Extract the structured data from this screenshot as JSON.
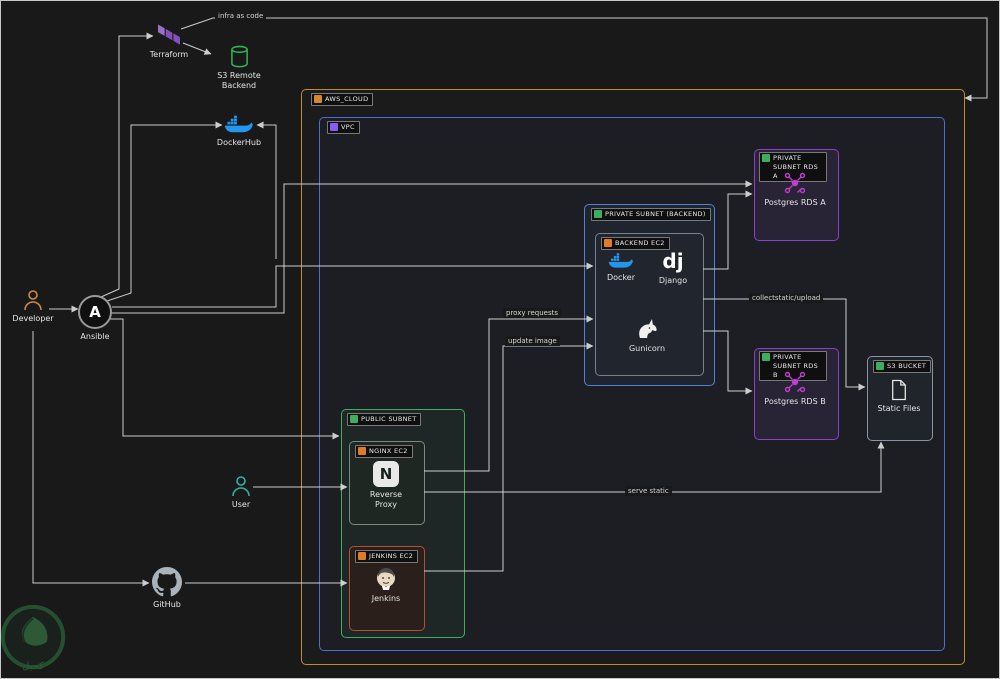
{
  "diagram": {
    "external": {
      "terraform": {
        "label": "Terraform"
      },
      "s3_remote_backend": {
        "label": "S3 Remote Backend"
      },
      "dockerhub": {
        "label": "DockerHub"
      },
      "developer": {
        "label": "Developer"
      },
      "ansible": {
        "label": "Ansible"
      },
      "user": {
        "label": "User"
      },
      "github": {
        "label": "GitHub"
      }
    },
    "aws": {
      "label": "AWS_CLOUD",
      "vpc": {
        "label": "VPC"
      },
      "backend_subnet": {
        "label": "PRIVATE SUBNET (BACKEND)"
      },
      "backend_ec2": {
        "label": "BACKEND EC2",
        "docker": "Docker",
        "django": "Django",
        "gunicorn": "Gunicorn"
      },
      "rds_subnet_a": {
        "label": "PRIVATE SUBNET RDS A",
        "node": "Postgres RDS A"
      },
      "rds_subnet_b": {
        "label": "PRIVATE SUBNET RDS B",
        "node": "Postgres RDS B"
      },
      "public_subnet": {
        "label": "PUBLIC SUBNET"
      },
      "nginx_ec2": {
        "label": "NGINX EC2",
        "node": "Reverse Proxy"
      },
      "jenkins_ec2": {
        "label": "JENKINS EC2",
        "node": "Jenkins"
      },
      "s3_bucket": {
        "label": "S3 BUCKET",
        "node": "Static Files"
      }
    },
    "edge_labels": {
      "infra_as_code": "infra as code",
      "proxy_requests": "proxy requests",
      "update_image": "update image",
      "collectstatic_upload": "collectstatic/upload",
      "serve_static": "serve static"
    },
    "watermark": "كحيل",
    "colors": {
      "aws_border": "#c08a2d",
      "vpc_border": "#4f6bd8",
      "subnet_blue_border": "#4f81d8",
      "subnet_green_border": "#3dae5e",
      "rds_purple_border": "#8a3fd0",
      "jenkins_border": "#b05038",
      "edge": "#dcdcdc",
      "terraform": "#844FBA",
      "docker_blue": "#2496ED",
      "rds_icon": "#c13dd4"
    }
  }
}
